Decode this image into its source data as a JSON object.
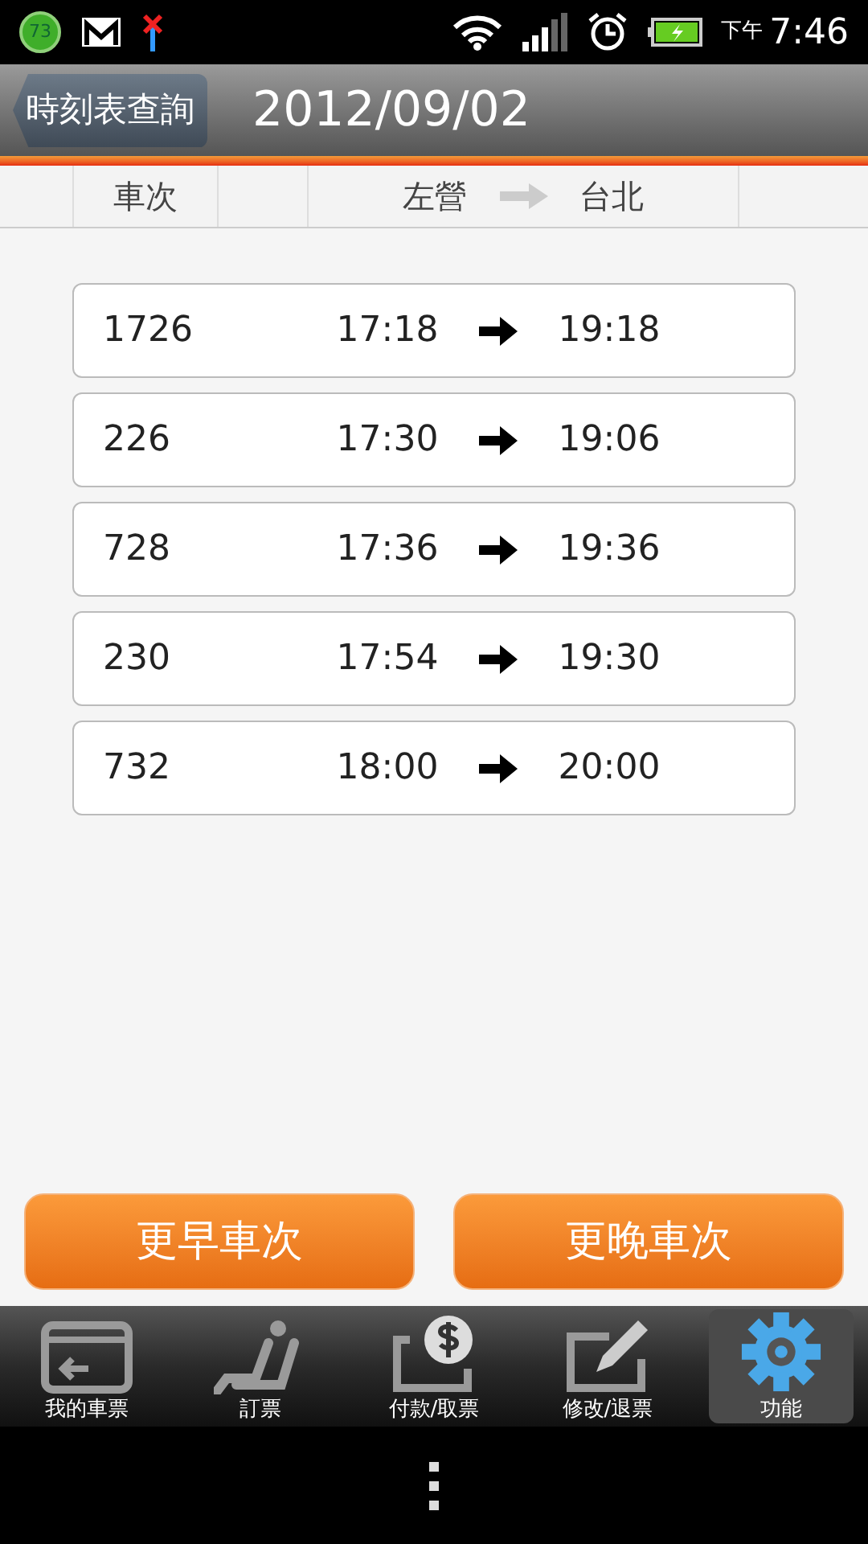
{
  "status_bar": {
    "badge": "73",
    "clock_period": "下午",
    "time": "7:46"
  },
  "header": {
    "back_button": "時刻表查詢",
    "title": "2012/09/02"
  },
  "columns": {
    "train": "車次",
    "from": "左營",
    "to": "台北"
  },
  "trains": [
    {
      "number": "1726",
      "depart": "17:18",
      "arrive": "19:18"
    },
    {
      "number": "226",
      "depart": "17:30",
      "arrive": "19:06"
    },
    {
      "number": "728",
      "depart": "17:36",
      "arrive": "19:36"
    },
    {
      "number": "230",
      "depart": "17:54",
      "arrive": "19:30"
    },
    {
      "number": "732",
      "depart": "18:00",
      "arrive": "20:00"
    }
  ],
  "buttons": [
    "更早車次",
    "更晚車次"
  ],
  "tabs": [
    {
      "kind": "ticket",
      "label": "我的車票",
      "selected": false
    },
    {
      "kind": "seat",
      "label": "訂票",
      "selected": false
    },
    {
      "kind": "pay",
      "label": "付款/取票",
      "selected": false
    },
    {
      "kind": "edit",
      "label": "修改/退票",
      "selected": false
    },
    {
      "kind": "gear",
      "label": "功能",
      "selected": true
    }
  ]
}
